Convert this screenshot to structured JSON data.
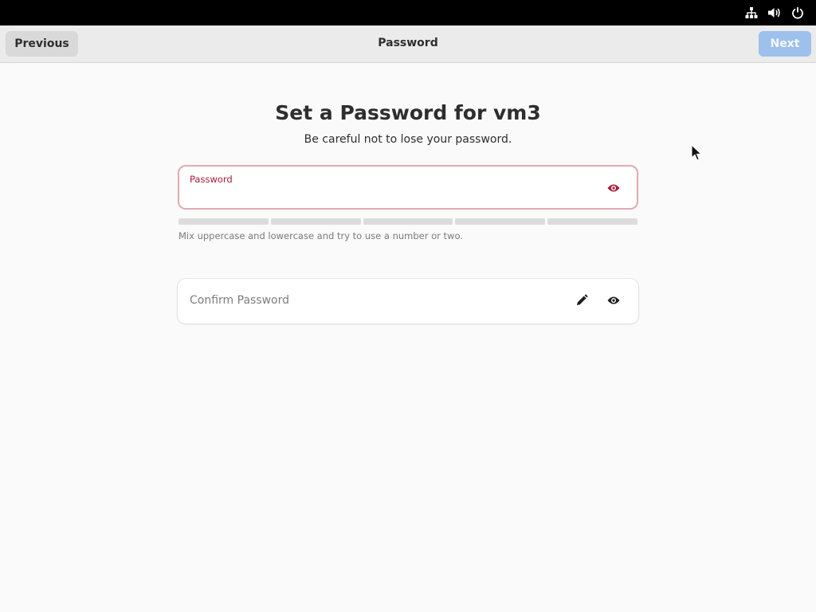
{
  "tray": {
    "icons": [
      "network-icon",
      "volume-icon",
      "power-icon"
    ]
  },
  "header": {
    "previous_label": "Previous",
    "title": "Password",
    "next_label": "Next"
  },
  "main": {
    "title": "Set a Password for vm3",
    "subtitle": "Be careful not to lose your password."
  },
  "password_field": {
    "label": "Password",
    "value": "",
    "reveal_icon": "eye-icon"
  },
  "strength_meter": {
    "segments": 5,
    "filled": 0
  },
  "hint": "Mix uppercase and lowercase and try to use a number or two.",
  "confirm_field": {
    "placeholder": "Confirm Password",
    "value": "",
    "edit_icon": "pencil-icon",
    "reveal_icon": "eye-icon"
  },
  "colors": {
    "topbar": "#000000",
    "header_bg": "#ebebeb",
    "accent_disabled": "#9ec0ec",
    "error": "#a61d3a",
    "error_border": "#e3a8b2",
    "background": "#fafafa"
  }
}
